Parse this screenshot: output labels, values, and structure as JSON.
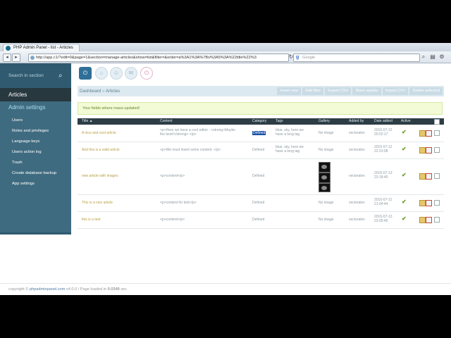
{
  "browser": {
    "tab_title": "PHP Admin Panel - list - Articles",
    "url": "http://app.c1/?edit=0&page=1&section=manage-articles&show=list&filter=&order=a%3A1%3A%7Bs%3A5%3A%22title%22%3",
    "search_placeholder": "Google",
    "icons": [
      "back-icon",
      "forward-icon",
      "globe-icon",
      "reload-icon",
      "google-icon",
      "search-icon",
      "page-icon",
      "gear-icon"
    ]
  },
  "sidebar": {
    "search_placeholder": "Search in section",
    "active_section": "Articles",
    "group_title": "Admin settings",
    "items": [
      {
        "label": "Users"
      },
      {
        "label": "Roles and privileges"
      },
      {
        "label": "Language keys"
      },
      {
        "label": "Users action log"
      },
      {
        "label": "Trash"
      },
      {
        "label": "Create database backup"
      },
      {
        "label": "App settings"
      }
    ]
  },
  "top_icons": [
    "power-icon",
    "home-icon",
    "user-icon",
    "mail-icon",
    "logout-icon"
  ],
  "breadcrumb": {
    "root": "Dashboard",
    "separator": "»",
    "current": "Articles"
  },
  "actions": [
    "Insert new",
    "Add filter",
    "Export CSV",
    "Mass update",
    "Import CSV",
    "Delete selected"
  ],
  "notice": "Your fields where mass-updated!",
  "table": {
    "headers": {
      "title": "Title ▲",
      "content": "Content",
      "category": "Category",
      "tags": "Tags",
      "gallery": "Gallery",
      "added_by": "Added by",
      "date_added": "Date added",
      "active": "Active"
    },
    "rows": [
      {
        "title": "A nice and cool article",
        "content_1": "<p>Here we have a cool editor : <strong>Maybe",
        "content_2": "the best!</strong> </p>",
        "category": "Defined",
        "tags_1": "blue, sky, here we",
        "tags_2": "have a long tag",
        "gallery": "No image",
        "added_by": "vectoralex",
        "date": "2015-07-12",
        "time": "20:02:17"
      },
      {
        "title": "And this is a valid article",
        "content_1": "<p>We must insert some content. </p>",
        "content_2": "",
        "category": "Defined",
        "tags_1": "blue, sky, here we",
        "tags_2": "have a long tag",
        "gallery": "No image",
        "added_by": "vectoralex",
        "date": "2015-07-12",
        "time": "22:23:08"
      },
      {
        "title": "new article with images",
        "content_1": "<p>content</p>",
        "content_2": "",
        "category": "Defined",
        "tags_1": "",
        "tags_2": "",
        "gallery": "",
        "added_by": "vectoralex",
        "date": "2015-07-13",
        "time": "23:18:40"
      },
      {
        "title": "This is a nice article",
        "content_1": "<p>content for test</p>",
        "content_2": "",
        "category": "Defined",
        "tags_1": "",
        "tags_2": "",
        "gallery": "No image",
        "added_by": "vectoralex",
        "date": "2015-07-12",
        "time": "21:04:44"
      },
      {
        "title": "this is a test",
        "content_1": "<p>content</p>",
        "content_2": "",
        "category": "Defined",
        "tags_1": "",
        "tags_2": "",
        "gallery": "No image",
        "added_by": "vectoralex",
        "date": "2015-07-13",
        "time": "23:05:46"
      }
    ]
  },
  "footer": {
    "prefix": "copyright ©",
    "link": "phpadminpanel.com",
    "version": "v4.0.0 / Page loaded in",
    "time": "0.0340",
    "unit": "sec"
  }
}
